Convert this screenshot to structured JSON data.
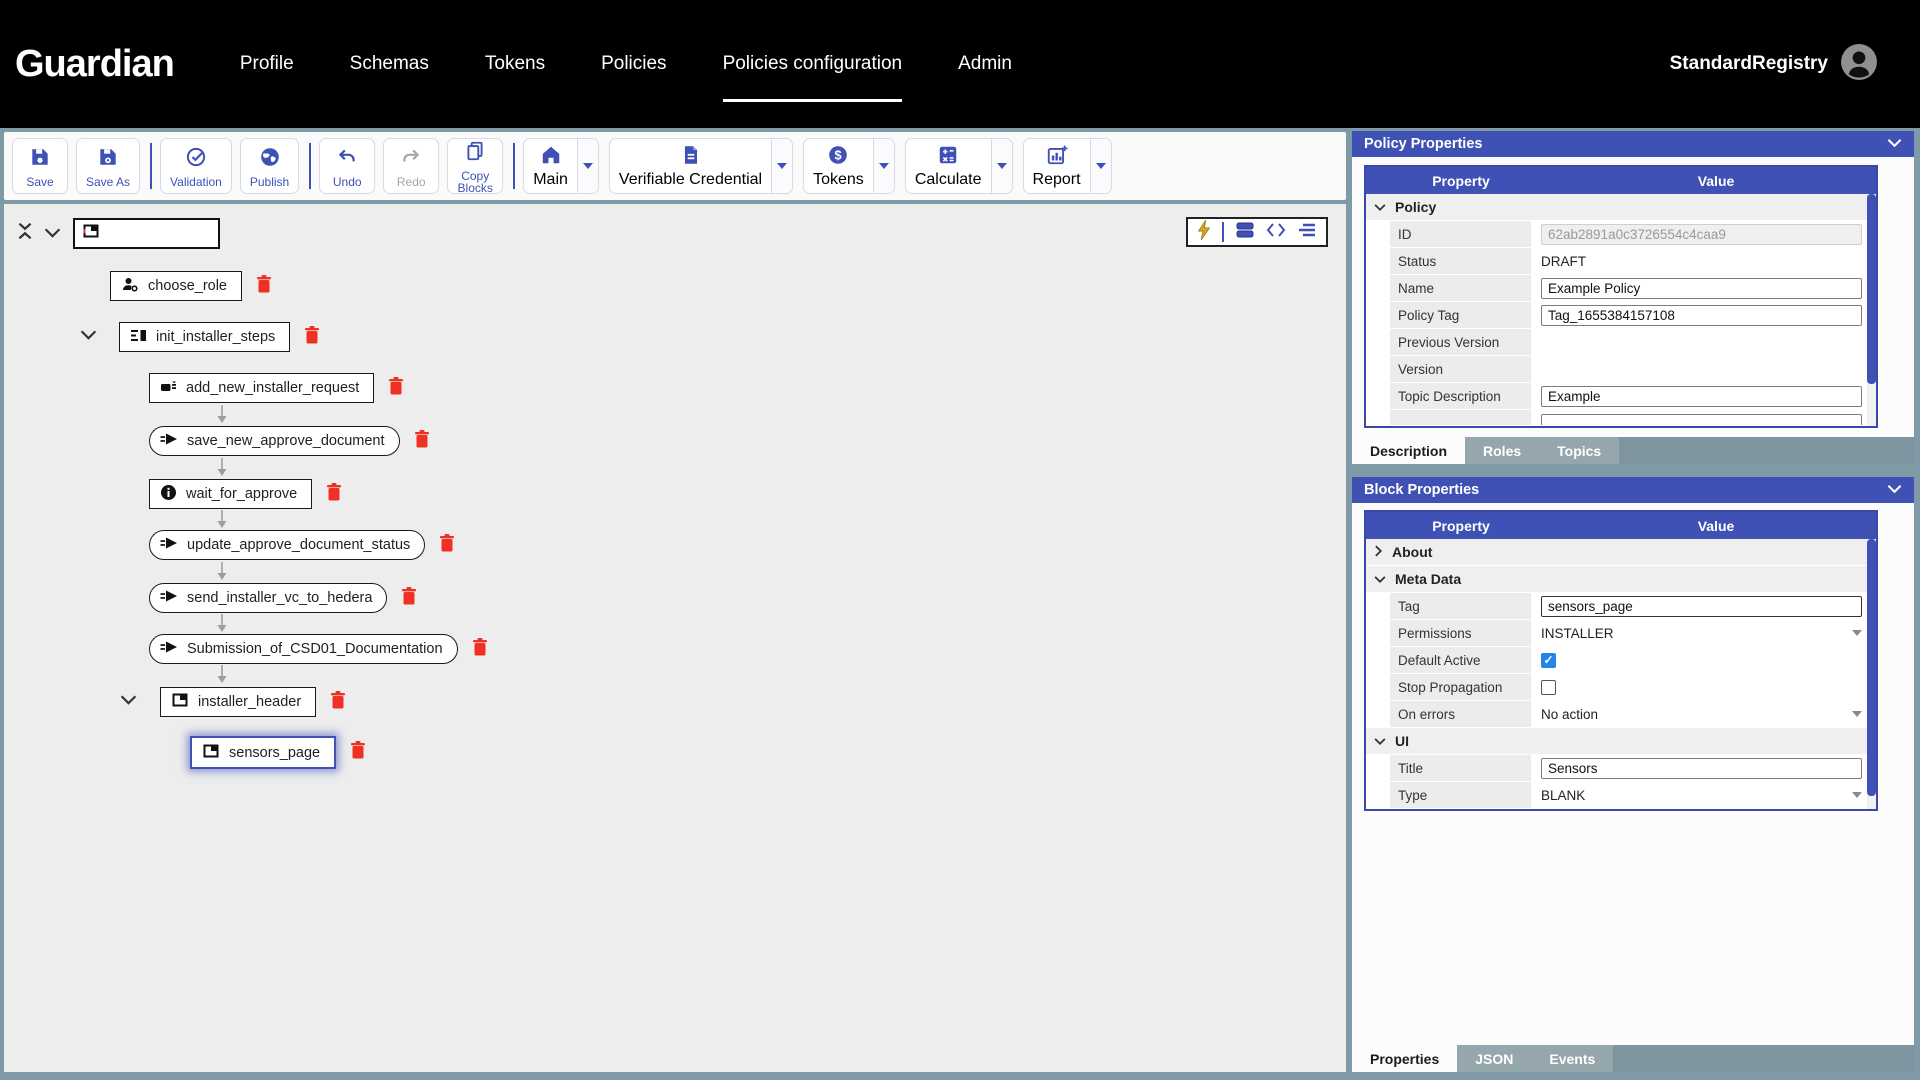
{
  "navbar": {
    "logo": "Guardian",
    "items": [
      {
        "label": "Profile"
      },
      {
        "label": "Schemas"
      },
      {
        "label": "Tokens"
      },
      {
        "label": "Policies"
      },
      {
        "label": "Policies configuration",
        "active": true
      },
      {
        "label": "Admin"
      }
    ],
    "user": {
      "name": "StandardRegistry",
      "icon": "user-avatar-icon"
    }
  },
  "toolbar": {
    "save": "Save",
    "save_as": "Save As",
    "validation": "Validation",
    "publish": "Publish",
    "undo": "Undo",
    "redo": "Redo",
    "copy_blocks": "Copy\nBlocks",
    "main": "Main",
    "verifiable_credential": "Verifiable\nCredential",
    "tokens": "Tokens",
    "calculate": "Calculate",
    "report": "Report"
  },
  "tree": {
    "view_icons": [
      "lightning-icon",
      "blocks-view-icon",
      "code-view-icon",
      "tree-view-icon"
    ],
    "blocks": [
      {
        "label": "choose_role",
        "icon": "roles-icon"
      },
      {
        "label": "init_installer_steps",
        "icon": "steps-icon",
        "expandable": true
      },
      {
        "label": "add_new_installer_request",
        "icon": "request-icon"
      },
      {
        "label": "save_new_approve_document",
        "icon": "send-icon"
      },
      {
        "label": "wait_for_approve",
        "icon": "information-icon"
      },
      {
        "label": "update_approve_document_status",
        "icon": "send-icon"
      },
      {
        "label": "send_installer_vc_to_hedera",
        "icon": "send-icon"
      },
      {
        "label": "Submission_of_CSD01_Documentation",
        "icon": "send-icon"
      },
      {
        "label": "installer_header",
        "icon": "container-icon",
        "expandable": true
      },
      {
        "label": "sensors_page",
        "icon": "container-icon",
        "selected": true
      }
    ]
  },
  "policy_properties": {
    "title": "Policy Properties",
    "columns": [
      "Property",
      "Value"
    ],
    "rows": [
      {
        "kind": "group",
        "label": "Policy",
        "expanded": true
      },
      {
        "kind": "disabled-input",
        "label": "ID",
        "value": "62ab2891a0c3726554c4caa9"
      },
      {
        "kind": "muted-text",
        "label": "Status",
        "value": "DRAFT"
      },
      {
        "kind": "input",
        "label": "Name",
        "value": "Example Policy"
      },
      {
        "kind": "input",
        "label": "Policy Tag",
        "value": "Tag_1655384157108"
      },
      {
        "kind": "text",
        "label": "Previous Version",
        "value": ""
      },
      {
        "kind": "text",
        "label": "Version",
        "value": ""
      },
      {
        "kind": "input",
        "label": "Topic Description",
        "value": "Example"
      }
    ],
    "tabs": [
      {
        "label": "Description",
        "active": true
      },
      {
        "label": "Roles"
      },
      {
        "label": "Topics"
      }
    ]
  },
  "block_properties": {
    "title": "Block Properties",
    "columns": [
      "Property",
      "Value"
    ],
    "rows": [
      {
        "kind": "group",
        "label": "About",
        "expanded": false
      },
      {
        "kind": "group",
        "label": "Meta Data",
        "expanded": true
      },
      {
        "kind": "input",
        "label": "Tag",
        "value": "sensors_page"
      },
      {
        "kind": "select",
        "label": "Permissions",
        "value": "INSTALLER"
      },
      {
        "kind": "checkbox",
        "label": "Default Active",
        "checked": true
      },
      {
        "kind": "checkbox",
        "label": "Stop Propagation",
        "checked": false
      },
      {
        "kind": "select",
        "label": "On errors",
        "value": "No action"
      },
      {
        "kind": "group",
        "label": "UI",
        "expanded": true
      },
      {
        "kind": "input",
        "label": "Title",
        "value": "Sensors"
      },
      {
        "kind": "select",
        "label": "Type",
        "value": "BLANK"
      }
    ],
    "tabs": [
      {
        "label": "Properties",
        "active": true
      },
      {
        "label": "JSON"
      },
      {
        "label": "Events"
      }
    ]
  },
  "colors": {
    "accent": "#3f51b5",
    "danger": "#ef3124",
    "frame": "#7f99a6",
    "checkbox_checked": "#2186e8",
    "lightning": "#d7a418"
  }
}
